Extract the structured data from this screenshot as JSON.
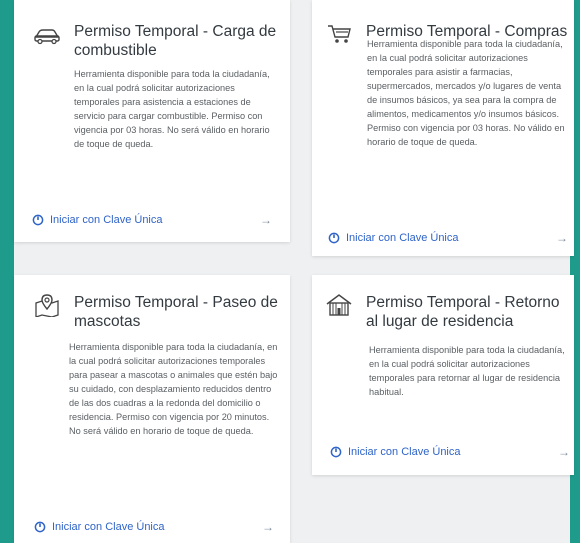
{
  "cards": [
    {
      "title": "Permiso Temporal - Carga de combustible",
      "icon": "car-icon",
      "description": "Herramienta disponible para toda la ciudadanía, en la cual podrá solicitar autorizaciones temporales para asistencia a estaciones de servicio para cargar combustible. Permiso con vigencia por 03 horas. No será válido en horario de toque de queda.",
      "cta_label": "Iniciar con Clave Única",
      "cta_arrow": "→"
    },
    {
      "title": "Permiso Temporal - Compras",
      "icon": "shopping-cart-icon",
      "description": "Herramienta disponible para toda la ciudadanía, en la cual podrá solicitar autorizaciones temporales para asistir a farmacias, supermercados, mercados y/o lugares de venta de insumos básicos, ya sea para la compra de alimentos, medicamentos y/o insumos básicos. Permiso con vigencia por 03 horas. No válido en horario de toque de queda.",
      "cta_label": "Iniciar con Clave Única",
      "cta_arrow": "→"
    },
    {
      "title": "Permiso Temporal - Paseo de mascotas",
      "icon": "map-pin-icon",
      "description": "Herramienta disponible para toda la ciudadanía, en la cual podrá solicitar autorizaciones temporales para pasear a mascotas o animales que estén bajo su cuidado, con desplazamiento reducidos dentro de las dos cuadras a la redonda del domicilio o residencia. Permiso con vigencia por 20 minutos. No será válido en horario de toque de queda.",
      "cta_label": "Iniciar con Clave Única",
      "cta_arrow": "→"
    },
    {
      "title": "Permiso Temporal - Retorno al lugar de residencia",
      "icon": "building-icon",
      "description": "Herramienta disponible para toda la ciudadanía, en la cual podrá solicitar autorizaciones temporales para retornar al lugar de residencia habitual.",
      "cta_label": "Iniciar con Clave Única",
      "cta_arrow": "→"
    }
  ],
  "colors": {
    "frame": "#1f9b8c",
    "link": "#2f64c8",
    "title": "#333a40",
    "text": "#5a5f63"
  }
}
